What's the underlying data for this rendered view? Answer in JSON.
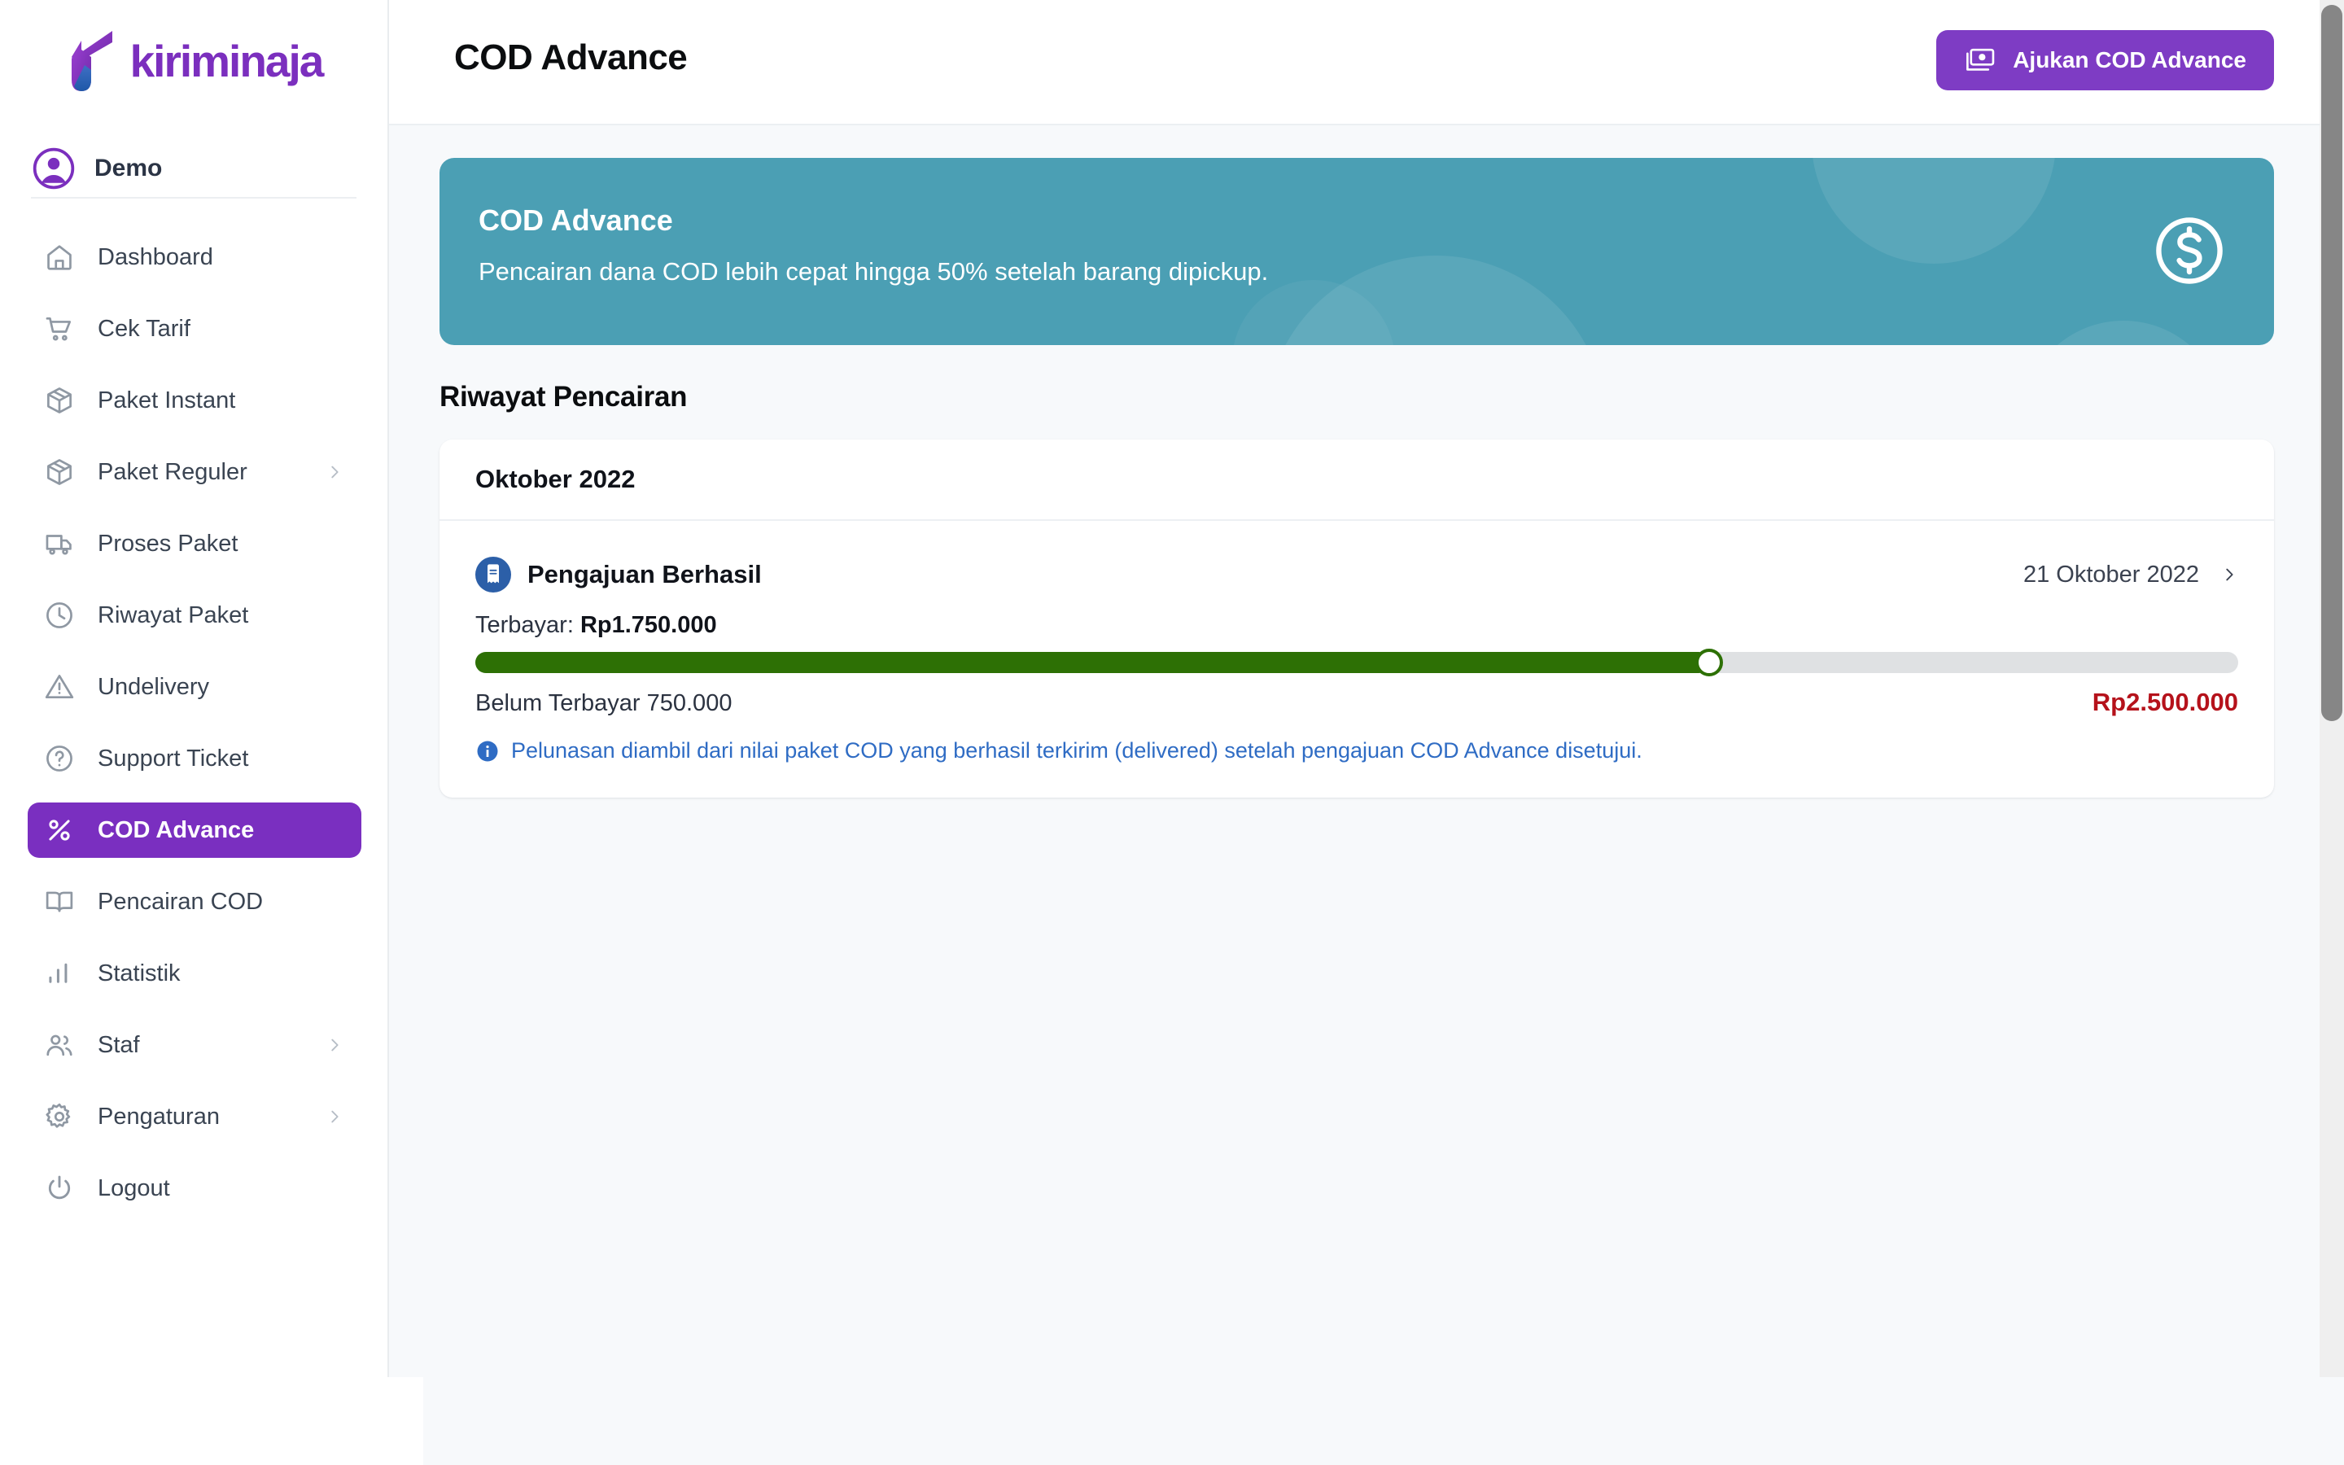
{
  "brand": {
    "name": "kiriminaja",
    "color": "#7b2fbe"
  },
  "sidebar": {
    "user": {
      "name": "Demo",
      "avatar_icon": "user-circle-icon"
    },
    "items": [
      {
        "label": "Dashboard",
        "icon": "home-icon",
        "chevron": false,
        "active": false
      },
      {
        "label": "Cek Tarif",
        "icon": "shopping-cart-icon",
        "chevron": false,
        "active": false
      },
      {
        "label": "Paket Instant",
        "icon": "package-icon",
        "chevron": false,
        "active": false
      },
      {
        "label": "Paket Reguler",
        "icon": "package-icon",
        "chevron": true,
        "active": false
      },
      {
        "label": "Proses Paket",
        "icon": "truck-icon",
        "chevron": false,
        "active": false
      },
      {
        "label": "Riwayat Paket",
        "icon": "clock-icon",
        "chevron": false,
        "active": false
      },
      {
        "label": "Undelivery",
        "icon": "warning-triangle-icon",
        "chevron": false,
        "active": false
      },
      {
        "label": "Support Ticket",
        "icon": "question-circle-icon",
        "chevron": false,
        "active": false
      },
      {
        "label": "COD Advance",
        "icon": "percent-icon",
        "chevron": false,
        "active": true
      },
      {
        "label": "Pencairan COD",
        "icon": "book-open-icon",
        "chevron": false,
        "active": false
      },
      {
        "label": "Statistik",
        "icon": "bar-chart-icon",
        "chevron": false,
        "active": false
      },
      {
        "label": "Staf",
        "icon": "users-icon",
        "chevron": true,
        "active": false
      },
      {
        "label": "Pengaturan",
        "icon": "gear-icon",
        "chevron": true,
        "active": false
      },
      {
        "label": "Logout",
        "icon": "power-icon",
        "chevron": false,
        "active": false
      }
    ]
  },
  "header": {
    "title": "COD Advance",
    "cta_label": "Ajukan COD Advance",
    "cta_icon": "cash-icon",
    "cta_color": "#7e3cc4"
  },
  "banner": {
    "title": "COD Advance",
    "subtitle": "Pencairan dana COD lebih cepat hingga 50% setelah barang dipickup.",
    "icon": "dollar-circle-icon",
    "bg_color": "#4b9fb4"
  },
  "main": {
    "section_title": "Riwayat Pencairan",
    "card": {
      "month": "Oktober 2022",
      "entries": [
        {
          "status_icon": "receipt-icon",
          "status_label": "Pengajuan Berhasil",
          "date": "21 Oktober 2022",
          "chevron_icon": "chevron-right-icon",
          "paid_label": "Terbayar:",
          "paid_amount": "Rp1.750.000",
          "progress_percent": 70,
          "progress_color": "#2d7005",
          "unpaid_label": "Belum Terbayar 750.000",
          "total_amount": "Rp2.500.000",
          "total_color": "#b5121b",
          "note_icon": "info-icon",
          "note": "Pelunasan diambil dari nilai paket COD yang berhasil terkirim (delivered) setelah pengajuan COD Advance disetujui."
        }
      ]
    }
  },
  "scrollbar": {
    "thumb_color": "#868686",
    "track_color": "#efefef"
  }
}
